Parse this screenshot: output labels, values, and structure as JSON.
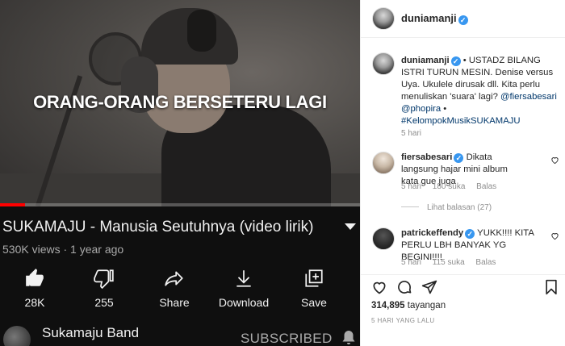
{
  "youtube": {
    "video": {
      "caption_text": "ORANG-ORANG BERSETERU LAGI",
      "progress_fraction": 0.07
    },
    "title": "SUKAMAJU - Manusia Seutuhnya (video lirik)",
    "views": "530K views",
    "age": "1 year ago",
    "meta_separator": "·",
    "actions": {
      "like": "28K",
      "dislike": "255",
      "share": "Share",
      "download": "Download",
      "save": "Save"
    },
    "channel": {
      "name": "Sukamaju Band",
      "subscribe_state": "SUBSCRIBED"
    }
  },
  "instagram": {
    "header_username": "duniamanji",
    "caption": {
      "username": "duniamanji",
      "text_1": " • USTADZ BILANG ISTRI TURUN MESIN. Denise versus Uya. Ukulele dirusak dll. Kita perlu menuliskan 'suara' lagi? ",
      "mention_1": "@fiersabesari",
      "text_2": " ",
      "mention_2": "@phopira",
      "text_3": " • ",
      "hashtag": "#KelompokMusikSUKAMAJU",
      "time": "5 hari"
    },
    "comments": [
      {
        "username": "fiersabesari",
        "text": " Dikata langsung hajar mini album kata gue juga",
        "time": "5 hari",
        "likes": "180 suka",
        "reply": "Balas",
        "view_replies": "Lihat balasan (27)"
      },
      {
        "username": "patrickeffendy",
        "text": " YUKK!!!! KITA PERLU LBH BANYAK YG BEGINI!!!!",
        "time": "5 hari",
        "likes": "115 suka",
        "reply": "Balas"
      }
    ],
    "views_count": "314,895",
    "views_label": " tayangan",
    "posted": "5 HARI YANG LALU"
  }
}
